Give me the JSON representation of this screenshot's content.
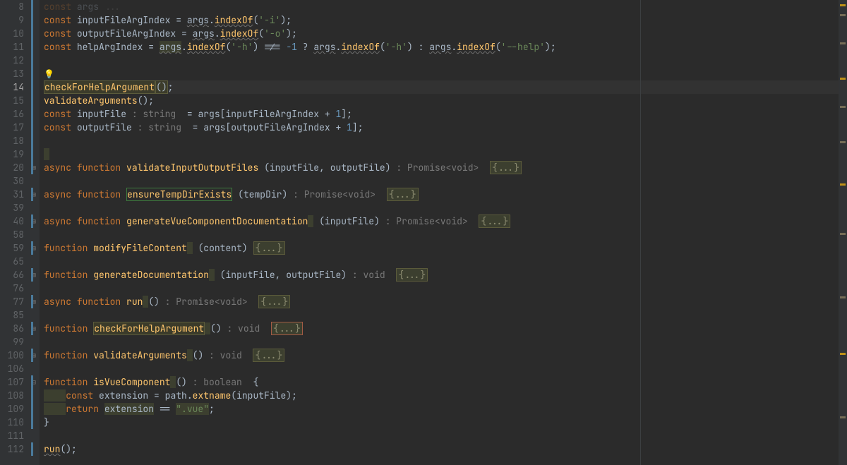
{
  "lines": [
    {
      "n": 8,
      "cb": true
    },
    {
      "n": 9,
      "cb": true
    },
    {
      "n": 10,
      "cb": true
    },
    {
      "n": 11,
      "cb": true
    },
    {
      "n": 12,
      "cb": true
    },
    {
      "n": 13,
      "cb": true,
      "bulb": true
    },
    {
      "n": 14,
      "cb": true,
      "current": true
    },
    {
      "n": 15,
      "cb": true
    },
    {
      "n": 16,
      "cb": true
    },
    {
      "n": 17,
      "cb": true
    },
    {
      "n": 18,
      "cb": true
    },
    {
      "n": 19,
      "cb": true
    },
    {
      "n": 20,
      "cb": true,
      "fold": "plus"
    },
    {
      "n": 30
    },
    {
      "n": 31,
      "cb": true,
      "fold": "plus"
    },
    {
      "n": 39
    },
    {
      "n": 40,
      "cb": true,
      "fold": "plus"
    },
    {
      "n": 58
    },
    {
      "n": 59,
      "cb": true,
      "fold": "plus"
    },
    {
      "n": 65
    },
    {
      "n": 66,
      "cb": true,
      "fold": "plus"
    },
    {
      "n": 76
    },
    {
      "n": 77,
      "cb": true,
      "fold": "plus"
    },
    {
      "n": 85
    },
    {
      "n": 86,
      "cb": true,
      "fold": "plus"
    },
    {
      "n": 99
    },
    {
      "n": 100,
      "cb": true,
      "fold": "plus"
    },
    {
      "n": 106
    },
    {
      "n": 107,
      "cb": true,
      "fold": "minus"
    },
    {
      "n": 108,
      "cb": true
    },
    {
      "n": 109,
      "cb": true
    },
    {
      "n": 110,
      "cb": true
    },
    {
      "n": 111
    },
    {
      "n": 112,
      "cb": true
    }
  ],
  "t": {
    "const": "const",
    "async": "async",
    "function": "function",
    "return": "return",
    "inputFileArgIndex": "inputFileArgIndex",
    "outputFileArgIndex": "outputFileArgIndex",
    "helpArgIndex": "helpArgIndex",
    "args": "args",
    "indexOf": "indexOf",
    "dash_i": "'-i'",
    "dash_o": "'-o'",
    "dash_h": "'-h'",
    "dhelp": "'--help'",
    "neg1": "-1",
    "one": "1",
    "checkForHelpArgument": "checkForHelpArgument",
    "validateArguments": "validateArguments",
    "inputFile": "inputFile",
    "outputFile": "outputFile",
    "hint_string": " : string ",
    "hint_pvoid": " : Promise<void> ",
    "hint_void": " : void ",
    "hint_bool": " : boolean ",
    "validateInputOutputFiles": "validateInputOutputFiles",
    "ensureTempDirExists": "ensureTempDirExists",
    "tempDir": "tempDir",
    "generateVueComponentDocumentation": "generateVueComponentDocumentation",
    "modifyFileContent": "modifyFileContent",
    "content": "content",
    "generateDocumentation": "generateDocumentation",
    "run": "run",
    "isVueComponent": "isVueComponent",
    "extension": "extension",
    "path": "path",
    "extname": "extname",
    "vue_str": "\".vue\"",
    "fold_body": "{...}",
    "eq": " = ",
    "eqeq": " == ",
    "neq": " !== ",
    "tern_q": " ? ",
    "tern_c": " : ",
    "lp": "(",
    "rp": ")",
    "lb": "{",
    "rb": "}",
    "lbr": "[",
    "rbr": "]",
    "semi": ";",
    "comma": ", ",
    "plus": " + ",
    "dot": ".",
    "empty_paren": "()",
    "bulb": "💡"
  }
}
